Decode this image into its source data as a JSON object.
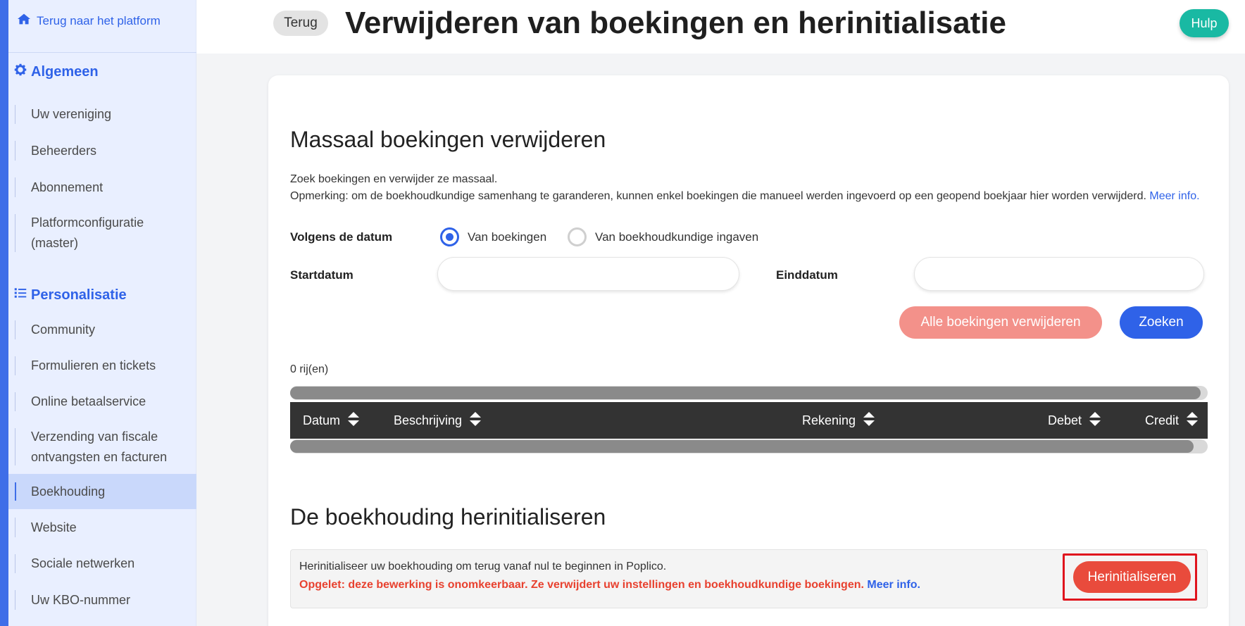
{
  "sidebar": {
    "back_link": "Terug naar het platform",
    "sections": [
      {
        "title": "Algemeen",
        "icon": "gear-icon",
        "items": [
          "Uw vereniging",
          "Beheerders",
          "Abonnement",
          "Platformconfiguratie (master)"
        ]
      },
      {
        "title": "Personalisatie",
        "icon": "list-icon",
        "items": [
          "Community",
          "Formulieren en tickets",
          "Online betaalservice",
          "Verzending van fiscale ontvangsten en facturen",
          "Boekhouding",
          "Website",
          "Sociale netwerken",
          "Uw KBO-nummer"
        ]
      }
    ],
    "active_item": "Boekhouding"
  },
  "header": {
    "back_button": "Terug",
    "title": "Verwijderen van boekingen en herinitialisatie",
    "help_button": "Hulp"
  },
  "mass_delete": {
    "title": "Massaal boekingen verwijderen",
    "description": "Zoek boekingen en verwijder ze massaal.",
    "note": "Opmerking: om de boekhoudkundige samenhang te garanderen, kunnen enkel boekingen die manueel werden ingevoerd op een geopend boekjaar hier worden verwijderd.",
    "note_link": "Meer info.",
    "date_mode_label": "Volgens de datum",
    "radio_options": [
      "Van boekingen",
      "Van boekhoudkundige ingaven"
    ],
    "selected_option": "Van boekingen",
    "start_label": "Startdatum",
    "start_value": "",
    "end_label": "Einddatum",
    "end_value": "",
    "delete_all_button": "Alle boekingen verwijderen",
    "search_button": "Zoeken",
    "row_count": "0 rij(en)",
    "table_columns": [
      "Datum",
      "Beschrijving",
      "Rekening",
      "Debet",
      "Credit"
    ],
    "table_rows": []
  },
  "reinit": {
    "title": "De boekhouding herinitialiseren",
    "text": "Herinitialiseer uw boekhouding om terug vanaf nul te beginnen in Poplico.",
    "warning": "Opgelet: deze bewerking is onomkeerbaar. Ze verwijdert uw instellingen en boekhoudkundige boekingen.",
    "warning_link": "Meer info.",
    "button": "Herinitialiseren"
  },
  "colors": {
    "primary": "#2f62e8",
    "danger": "#e94b3c",
    "danger_light": "#f3918a",
    "help": "#19b9a3",
    "table_header": "#333333",
    "highlight": "#e0141d"
  }
}
